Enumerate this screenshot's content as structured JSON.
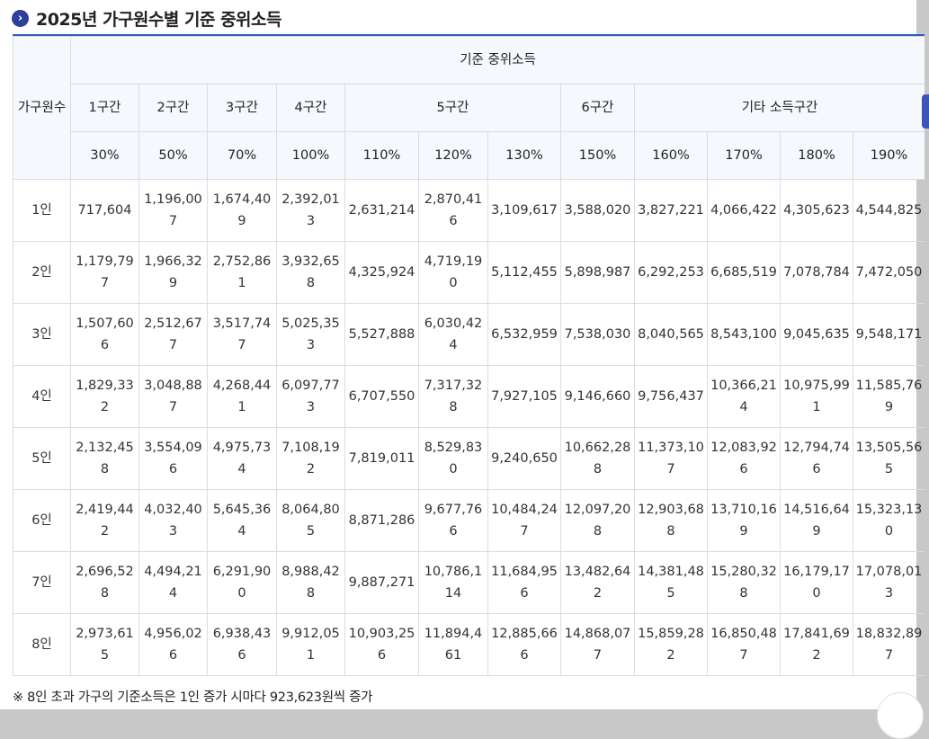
{
  "title": {
    "bullet": "›",
    "text": "2025년 가구원수별 기준 중위소득"
  },
  "table": {
    "row_header": "가구원수",
    "group_header": "기준 중위소득",
    "brackets": [
      {
        "label": "1구간",
        "span": 1
      },
      {
        "label": "2구간",
        "span": 1
      },
      {
        "label": "3구간",
        "span": 1
      },
      {
        "label": "4구간",
        "span": 1
      },
      {
        "label": "5구간",
        "span": 3
      },
      {
        "label": "6구간",
        "span": 1
      },
      {
        "label": "기타 소득구간",
        "span": 4
      }
    ],
    "percents": [
      "30%",
      "50%",
      "70%",
      "100%",
      "110%",
      "120%",
      "130%",
      "150%",
      "160%",
      "170%",
      "180%",
      "190%"
    ],
    "rows": [
      {
        "label": "1인",
        "values": [
          "717,604",
          "1,196,007",
          "1,674,409",
          "2,392,013",
          "2,631,214",
          "2,870,416",
          "3,109,617",
          "3,588,020",
          "3,827,221",
          "4,066,422",
          "4,305,623",
          "4,544,825"
        ]
      },
      {
        "label": "2인",
        "values": [
          "1,179,797",
          "1,966,329",
          "2,752,861",
          "3,932,658",
          "4,325,924",
          "4,719,190",
          "5,112,455",
          "5,898,987",
          "6,292,253",
          "6,685,519",
          "7,078,784",
          "7,472,050"
        ]
      },
      {
        "label": "3인",
        "values": [
          "1,507,606",
          "2,512,677",
          "3,517,747",
          "5,025,353",
          "5,527,888",
          "6,030,424",
          "6,532,959",
          "7,538,030",
          "8,040,565",
          "8,543,100",
          "9,045,635",
          "9,548,171"
        ]
      },
      {
        "label": "4인",
        "values": [
          "1,829,332",
          "3,048,887",
          "4,268,441",
          "6,097,773",
          "6,707,550",
          "7,317,328",
          "7,927,105",
          "9,146,660",
          "9,756,437",
          "10,366,214",
          "10,975,991",
          "11,585,769"
        ]
      },
      {
        "label": "5인",
        "values": [
          "2,132,458",
          "3,554,096",
          "4,975,734",
          "7,108,192",
          "7,819,011",
          "8,529,830",
          "9,240,650",
          "10,662,288",
          "11,373,107",
          "12,083,926",
          "12,794,746",
          "13,505,565"
        ]
      },
      {
        "label": "6인",
        "values": [
          "2,419,442",
          "4,032,403",
          "5,645,364",
          "8,064,805",
          "8,871,286",
          "9,677,766",
          "10,484,247",
          "12,097,208",
          "12,903,688",
          "13,710,169",
          "14,516,649",
          "15,323,130"
        ]
      },
      {
        "label": "7인",
        "values": [
          "2,696,528",
          "4,494,214",
          "6,291,900",
          "8,988,428",
          "9,887,271",
          "10,786,114",
          "11,684,956",
          "13,482,642",
          "14,381,485",
          "15,280,328",
          "16,179,170",
          "17,078,013"
        ]
      },
      {
        "label": "8인",
        "values": [
          "2,973,615",
          "4,956,026",
          "6,938,436",
          "9,912,051",
          "10,903,256",
          "11,894,461",
          "12,885,666",
          "14,868,077",
          "15,859,282",
          "16,850,487",
          "17,841,692",
          "18,832,897"
        ]
      }
    ]
  },
  "footnote": "※ 8인 초과 가구의 기준소득은 1인 증가 시마다 923,623원씩 증가",
  "colors": {
    "accent": "#2c5fb8",
    "header_bg": "#f5f8fc",
    "border": "#d9dde3"
  }
}
